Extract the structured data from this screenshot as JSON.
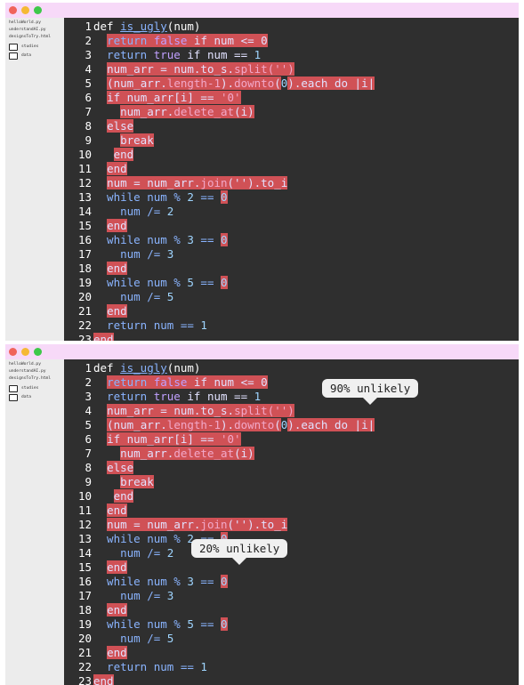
{
  "sidebar": {
    "files": [
      "helloWorld.py",
      "understandAI.py",
      "designsToTry.html"
    ],
    "folders": [
      "studies",
      "data"
    ]
  },
  "code_lines": [
    "def is_ugly(num)",
    "  return false if num <= 0",
    "  return true if num == 1",
    "  num_arr = num.to_s.split('')",
    "  (num_arr.length-1).downto(0).each do |i|",
    "  if num_arr[i] == '0'",
    "    num_arr.delete_at(i)",
    "  else",
    "    break",
    "   end",
    "  end",
    "  num = num_arr.join('').to_i",
    "  while num % 2 == 0",
    "    num /= 2",
    "  end",
    "  while num % 3 == 0",
    "    num /= 3",
    "  end",
    "  while num % 5 == 0",
    "    num /= 5",
    "  end",
    "  return num == 1",
    "end"
  ],
  "tooltips": {
    "line4": "90% unlikely",
    "line16": "20% unlikely"
  },
  "colors": {
    "highlight": "#de555a",
    "editor_bg": "#2f2f2f",
    "titlebar": "#f7d9f8"
  }
}
